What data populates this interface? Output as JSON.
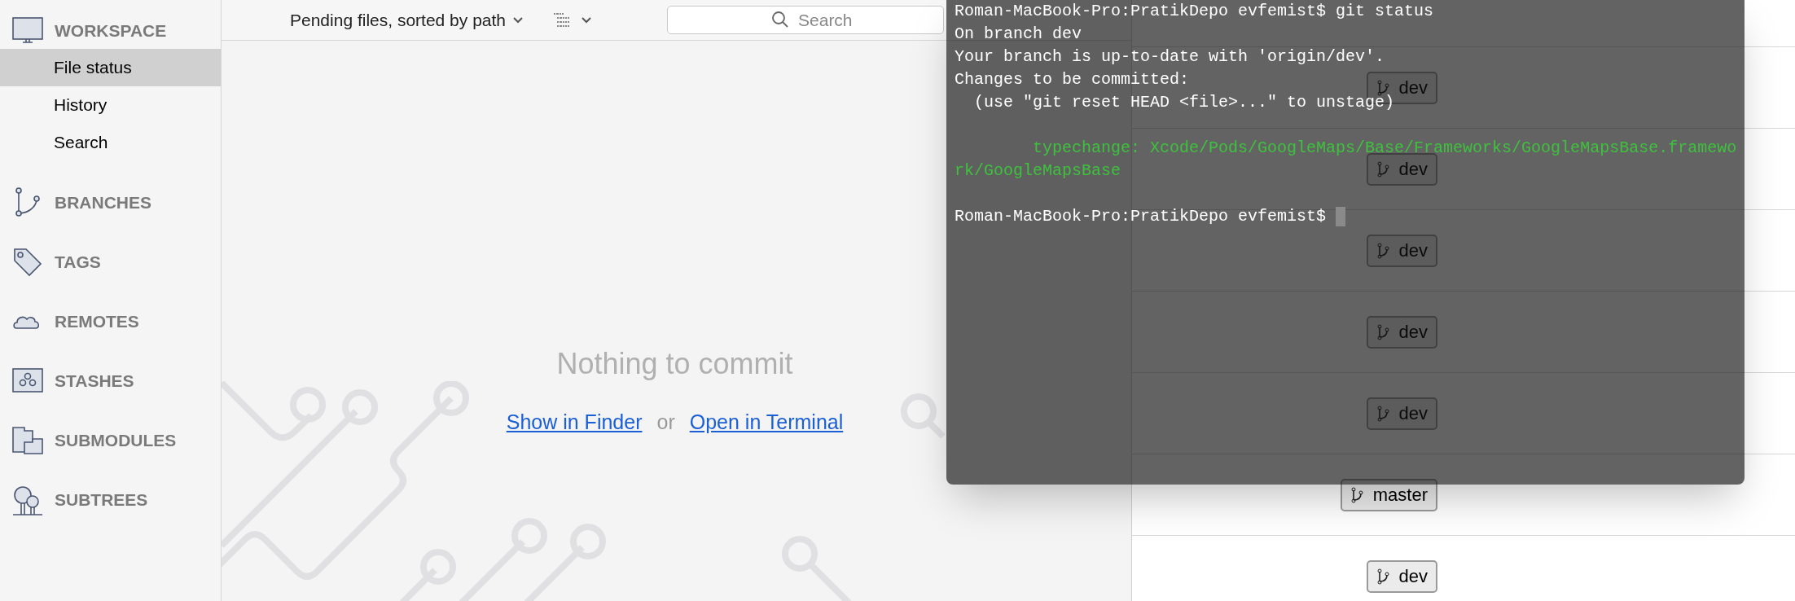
{
  "sidebar": {
    "sections": [
      {
        "kind": "workspace",
        "label": "WORKSPACE",
        "items": [
          {
            "label": "File status",
            "selected": true
          },
          {
            "label": "History",
            "selected": false
          },
          {
            "label": "Search",
            "selected": false
          }
        ]
      },
      {
        "kind": "branches",
        "label": "BRANCHES"
      },
      {
        "kind": "tags",
        "label": "TAGS"
      },
      {
        "kind": "remotes",
        "label": "REMOTES"
      },
      {
        "kind": "stashes",
        "label": "STASHES"
      },
      {
        "kind": "submodules",
        "label": "SUBMODULES"
      },
      {
        "kind": "subtrees",
        "label": "SUBTREES"
      }
    ]
  },
  "toolbar": {
    "sort_menu": "Pending files, sorted by path",
    "search": {
      "placeholder": "Search"
    }
  },
  "content": {
    "message": "Nothing to commit",
    "links": [
      "Show in Finder",
      "Open in Terminal"
    ],
    "separator": "or"
  },
  "history": {
    "rows": [
      {
        "branch": "dev"
      },
      {
        "branch": "dev"
      },
      {
        "branch": "dev"
      },
      {
        "branch": "dev"
      },
      {
        "branch": "dev"
      },
      {
        "branch": "master"
      },
      {
        "branch": "dev"
      }
    ]
  },
  "terminal": {
    "lines": [
      {
        "kind": "prompt",
        "text": "Roman-MacBook-Pro:PratikDepo evfemist$ git status"
      },
      {
        "kind": "plain",
        "text": "On branch dev"
      },
      {
        "kind": "plain",
        "text": "Your branch is up-to-date with 'origin/dev'."
      },
      {
        "kind": "plain",
        "text": "Changes to be committed:"
      },
      {
        "kind": "plain",
        "text": "  (use \"git reset HEAD <file>...\" to unstage)"
      },
      {
        "kind": "blank"
      },
      {
        "kind": "green",
        "text": "        typechange: Xcode/Pods/GoogleMaps/Base/Frameworks/GoogleMapsBase.framewo"
      },
      {
        "kind": "green",
        "text": "rk/GoogleMapsBase"
      },
      {
        "kind": "blank"
      },
      {
        "kind": "cursor",
        "text": "Roman-MacBook-Pro:PratikDepo evfemist$ "
      }
    ]
  }
}
